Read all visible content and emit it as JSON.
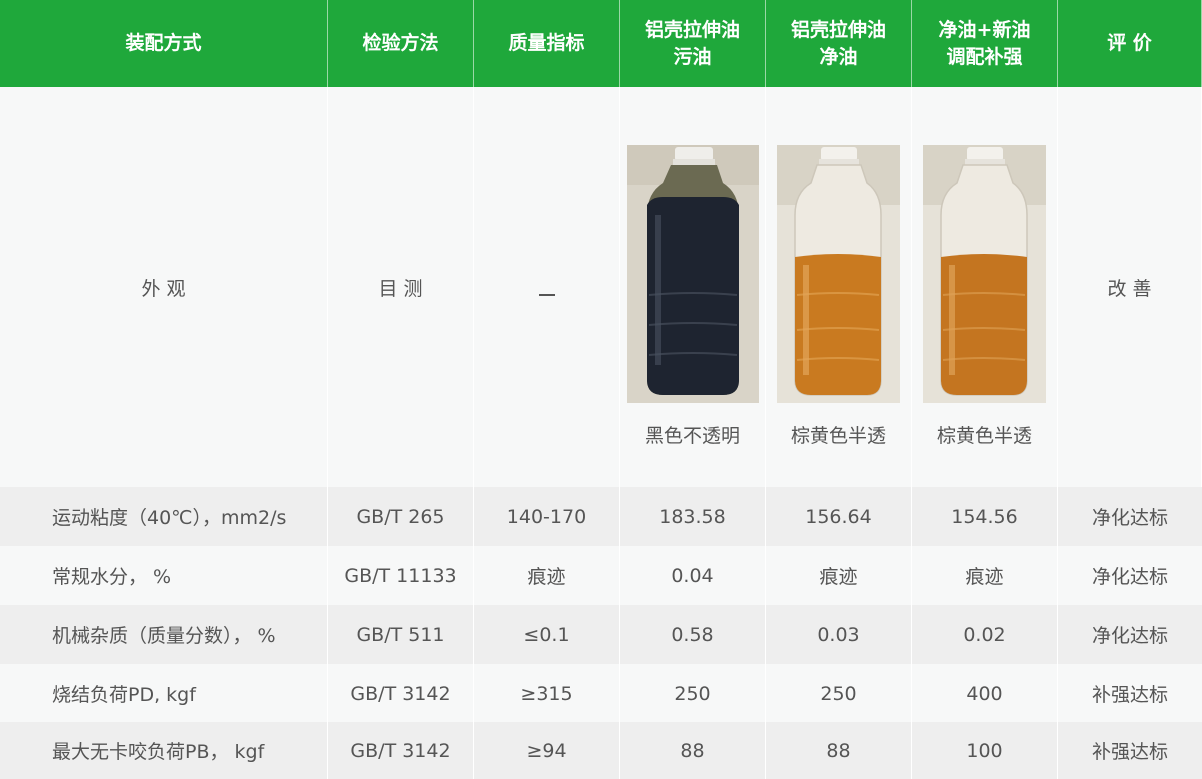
{
  "headers": [
    "装配方式",
    "检验方法",
    "质量指标",
    "铝壳拉伸油\n污油",
    "铝壳拉伸油\n净油",
    "净油+新油\n调配补强",
    "评  价"
  ],
  "appearance": {
    "label": "外  观",
    "method": "目  测",
    "spec": "—",
    "samples": [
      {
        "caption": "黑色不透明",
        "liquid_color": "#1e2430",
        "top_color": "#6b6a52"
      },
      {
        "caption": "棕黄色半透",
        "liquid_color": "#c97a20",
        "top_color": "#e9e3d6"
      },
      {
        "caption": "棕黄色半透",
        "liquid_color": "#c47520",
        "top_color": "#ece6d9"
      }
    ],
    "evaluation": "改  善"
  },
  "rows": [
    {
      "item": "运动粘度（40℃），mm2/s",
      "method": "GB/T 265",
      "spec": "140-170",
      "dirty": "183.58",
      "clean": "156.64",
      "blended": "154.56",
      "evaluation": "净化达标"
    },
    {
      "item": "常规水分， %",
      "method": "GB/T 11133",
      "spec": "痕迹",
      "dirty": "0.04",
      "clean": "痕迹",
      "blended": "痕迹",
      "evaluation": "净化达标"
    },
    {
      "item": "机械杂质（质量分数）， %",
      "method": "GB/T 511",
      "spec": "≤0.1",
      "dirty": "0.58",
      "clean": "0.03",
      "blended": "0.02",
      "evaluation": "净化达标"
    },
    {
      "item": "烧结负荷PD, kgf",
      "method": "GB/T 3142",
      "spec": "≥315",
      "dirty": "250",
      "clean": "250",
      "blended": "400",
      "evaluation": "补强达标"
    },
    {
      "item": "最大无卡咬负荷PB， kgf",
      "method": "GB/T 3142",
      "spec": "≥94",
      "dirty": "88",
      "clean": "88",
      "blended": "100",
      "evaluation": "补强达标"
    }
  ],
  "colors": {
    "header_bg": "#1fa83b",
    "row_light": "#f7f8f8",
    "row_dark": "#eeeeee",
    "text": "#555555"
  }
}
